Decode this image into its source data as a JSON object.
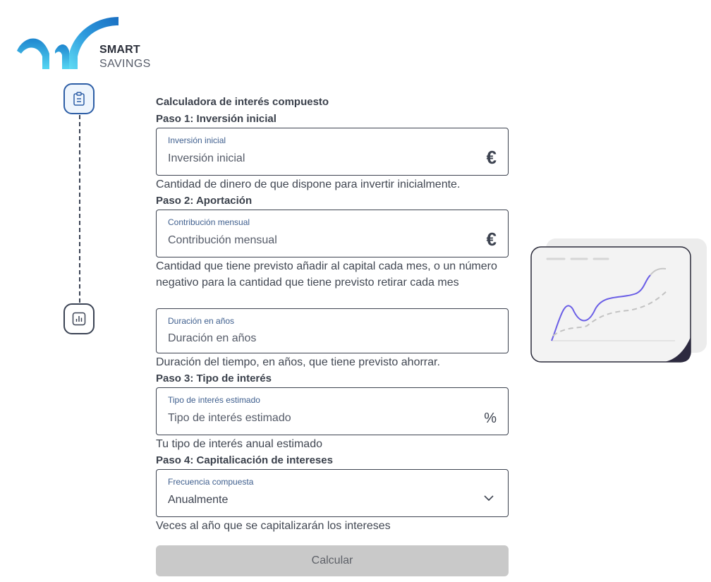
{
  "brand": {
    "line1": "SMART",
    "line2": "SAVINGS"
  },
  "calculator": {
    "title": "Calculadora de interés compuesto",
    "steps": [
      {
        "title": "Paso 1: Inversión inicial",
        "field": {
          "label": "Inversión inicial",
          "placeholder": "Inversión inicial",
          "suffix": "€"
        },
        "help": "Cantidad de dinero de que dispone para invertir inicialmente."
      },
      {
        "title": "Paso 2: Aportación",
        "field": {
          "label": "Contribución mensual",
          "placeholder": "Contribución mensual",
          "suffix": "€"
        },
        "help": "Cantidad que tiene previsto añadir al capital cada mes, o un número negativo para la cantidad que tiene previsto retirar cada mes",
        "field2": {
          "label": "Duración en años",
          "placeholder": "Duración en años"
        },
        "help2": "Duración del tiempo, en años, que tiene previsto ahorrar."
      },
      {
        "title": "Paso 3: Tipo de interés",
        "field": {
          "label": "Tipo de interés estimado",
          "placeholder": "Tipo de interés estimado",
          "suffix": "%"
        },
        "help": "Tu tipo de interés anual estimado"
      },
      {
        "title": "Paso 4: Capitalicación de intereses",
        "field": {
          "label": "Frecuencia compuesta",
          "value": "Anualmente",
          "icon": "chevron-down-icon"
        },
        "help": "Veces al año que se capitalizarán los intereses"
      }
    ],
    "submit_label": "Calcular"
  },
  "stepper": {
    "icons": [
      "clipboard-icon",
      "bar-chart-icon"
    ]
  },
  "colors": {
    "accent": "#2d5ea6",
    "brand_blue": "#1f8fd4",
    "brand_cyan": "#4fd3f0",
    "button_disabled": "#c9c9c9",
    "chart_line": "#6a5ee6"
  }
}
